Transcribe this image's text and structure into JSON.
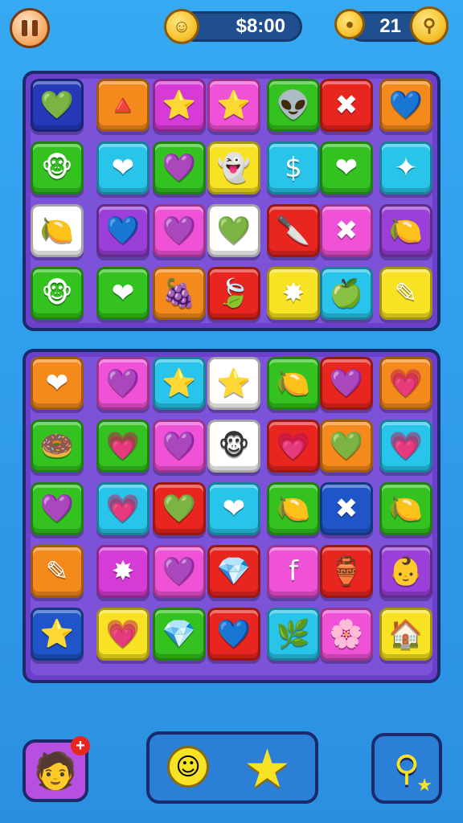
{
  "hud": {
    "money_label": "$8:00",
    "gems_label": "21",
    "icons": [
      "pause-icon",
      "smile-coin-icon",
      "map-pin-icon",
      "key-coin-icon"
    ]
  },
  "colors": {
    "red": "#e8251f",
    "orange": "#f48a1c",
    "yellow": "#f7e224",
    "green": "#33c21f",
    "cyan": "#29c4ea",
    "blue": "#1f55c8",
    "purple": "#9a3fd8",
    "pink": "#ef52d6",
    "magenta": "#d63bd6",
    "white": "#ffffff",
    "navy": "#2438b8"
  },
  "board_top": [
    [
      {
        "c": "navy",
        "s": "💚"
      },
      {
        "c": "orange",
        "s": "🔺"
      },
      {
        "c": "magenta",
        "s": "⭐"
      },
      {
        "c": "pink",
        "s": "⭐"
      },
      {
        "c": "green",
        "s": "👽"
      },
      {
        "c": "red",
        "s": "✖"
      },
      {
        "c": "orange",
        "s": "💙"
      }
    ],
    [
      {
        "c": "green",
        "s": "🐵"
      },
      {
        "c": "cyan",
        "s": "❤"
      },
      {
        "c": "green",
        "s": "💜"
      },
      {
        "c": "yellow",
        "s": "👻"
      },
      {
        "c": "cyan",
        "s": "$"
      },
      {
        "c": "green",
        "s": "❤"
      },
      {
        "c": "cyan",
        "s": "✦"
      }
    ],
    [
      {
        "c": "white",
        "s": "🍋"
      },
      {
        "c": "purple",
        "s": "💙"
      },
      {
        "c": "pink",
        "s": "💜"
      },
      {
        "c": "white",
        "s": "💚"
      },
      {
        "c": "red",
        "s": "🔪"
      },
      {
        "c": "pink",
        "s": "✖"
      },
      {
        "c": "purple",
        "s": "🍋"
      }
    ],
    [
      {
        "c": "green",
        "s": "🐵"
      },
      {
        "c": "green",
        "s": "❤"
      },
      {
        "c": "orange",
        "s": "🍇"
      },
      {
        "c": "red",
        "s": "🍃"
      },
      {
        "c": "yellow",
        "s": "✸"
      },
      {
        "c": "cyan",
        "s": "🍏"
      },
      {
        "c": "yellow",
        "s": "✎"
      }
    ]
  ],
  "board_bottom": [
    [
      {
        "c": "orange",
        "s": "❤"
      },
      {
        "c": "pink",
        "s": "💜"
      },
      {
        "c": "cyan",
        "s": "⭐"
      },
      {
        "c": "white",
        "s": "⭐"
      },
      {
        "c": "green",
        "s": "🍋"
      },
      {
        "c": "red",
        "s": "💜"
      },
      {
        "c": "orange",
        "s": "💗"
      }
    ],
    [
      {
        "c": "green",
        "s": "🍩"
      },
      {
        "c": "green",
        "s": "💗"
      },
      {
        "c": "pink",
        "s": "💜"
      },
      {
        "c": "white",
        "s": "🐵"
      },
      {
        "c": "red",
        "s": "💗"
      },
      {
        "c": "orange",
        "s": "💚"
      },
      {
        "c": "cyan",
        "s": "💗"
      }
    ],
    [
      {
        "c": "green",
        "s": "💜"
      },
      {
        "c": "cyan",
        "s": "💗"
      },
      {
        "c": "red",
        "s": "💚"
      },
      {
        "c": "cyan",
        "s": "❤"
      },
      {
        "c": "green",
        "s": "🍋"
      },
      {
        "c": "blue",
        "s": "✖"
      },
      {
        "c": "green",
        "s": "🍋"
      }
    ],
    [
      {
        "c": "orange",
        "s": "✎"
      },
      {
        "c": "magenta",
        "s": "✸"
      },
      {
        "c": "pink",
        "s": "💜"
      },
      {
        "c": "red",
        "s": "💎"
      },
      {
        "c": "pink",
        "s": "f"
      },
      {
        "c": "red",
        "s": "🏺"
      },
      {
        "c": "purple",
        "s": "👶"
      }
    ],
    [
      {
        "c": "blue",
        "s": "⭐"
      },
      {
        "c": "yellow",
        "s": "💗"
      },
      {
        "c": "green",
        "s": "💎"
      },
      {
        "c": "red",
        "s": "💙"
      },
      {
        "c": "cyan",
        "s": "🌿"
      },
      {
        "c": "pink",
        "s": "🌸"
      },
      {
        "c": "yellow",
        "s": "🏠"
      }
    ]
  ],
  "bottom_bar": {
    "icons": [
      "avatar-add-icon",
      "smiley-booster-icon",
      "star-booster-icon",
      "hint-key-icon"
    ]
  }
}
